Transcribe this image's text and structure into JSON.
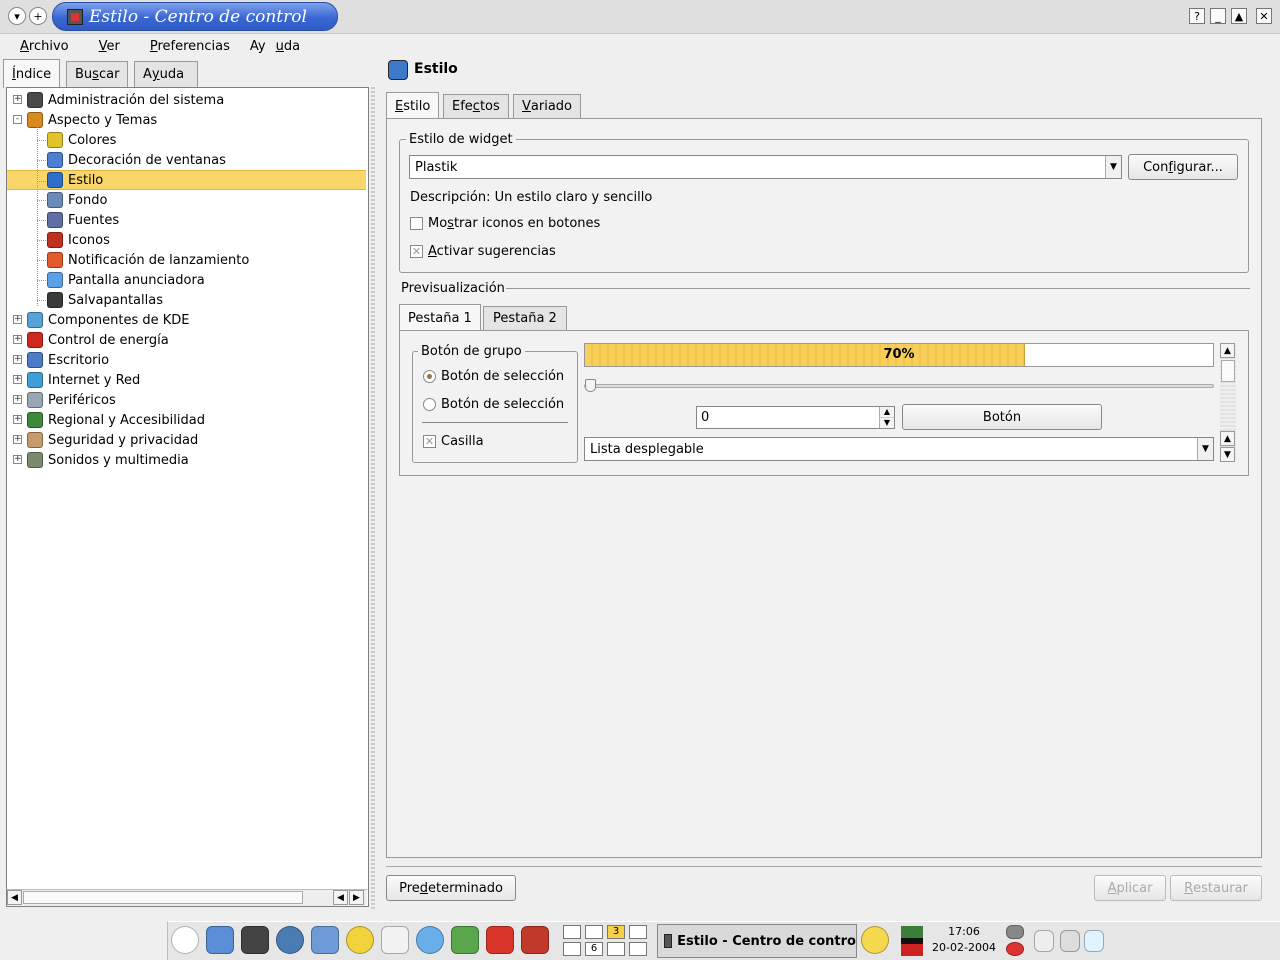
{
  "window": {
    "title": "Estilo - Centro de control"
  },
  "menu": [
    {
      "pre": "",
      "key": "A",
      "post": "rchivo"
    },
    {
      "pre": "",
      "key": "V",
      "post": "er"
    },
    {
      "pre": "",
      "key": "P",
      "post": "referencias"
    },
    {
      "pre": "Ay",
      "key": "u",
      "post": "da"
    }
  ],
  "sidebar_tabs": [
    {
      "pre": "",
      "key": "Í",
      "post": "ndice"
    },
    {
      "pre": "Bu",
      "key": "s",
      "post": "car"
    },
    {
      "pre": "A",
      "key": "y",
      "post": "uda"
    }
  ],
  "tree": [
    {
      "label": "Administración del sistema",
      "level": 0,
      "expander": "+",
      "color": "#4a4a4a"
    },
    {
      "label": "Aspecto y Temas",
      "level": 0,
      "expander": "-",
      "color": "#d98a1c"
    },
    {
      "label": "Colores",
      "level": 1,
      "color": "#e0c22a"
    },
    {
      "label": "Decoración de ventanas",
      "level": 1,
      "color": "#4d7fd0"
    },
    {
      "label": "Estilo",
      "level": 1,
      "color": "#2f6fcc",
      "selected": true
    },
    {
      "label": "Fondo",
      "level": 1,
      "color": "#6a8bb8"
    },
    {
      "label": "Fuentes",
      "level": 1,
      "color": "#5f6fa3"
    },
    {
      "label": "Iconos",
      "level": 1,
      "color": "#c03020"
    },
    {
      "label": "Notificación de lanzamiento",
      "level": 1,
      "color": "#e25a2b"
    },
    {
      "label": "Pantalla anunciadora",
      "level": 1,
      "color": "#5aa0e6"
    },
    {
      "label": "Salvapantallas",
      "level": 1,
      "color": "#3a3a3a"
    },
    {
      "label": "Componentes de KDE",
      "level": 0,
      "expander": "+",
      "color": "#55a3d8"
    },
    {
      "label": "Control de energía",
      "level": 0,
      "expander": "+",
      "color": "#cc2a1e"
    },
    {
      "label": "Escritorio",
      "level": 0,
      "expander": "+",
      "color": "#4a7cc8"
    },
    {
      "label": "Internet y Red",
      "level": 0,
      "expander": "+",
      "color": "#3e9fd6"
    },
    {
      "label": "Periféricos",
      "level": 0,
      "expander": "+",
      "color": "#9aa6b4"
    },
    {
      "label": "Regional y Accesibilidad",
      "level": 0,
      "expander": "+",
      "color": "#3f8a3a"
    },
    {
      "label": "Seguridad y privacidad",
      "level": 0,
      "expander": "+",
      "color": "#c69a6a"
    },
    {
      "label": "Sonidos y multimedia",
      "level": 0,
      "expander": "+",
      "color": "#7a8a6a"
    }
  ],
  "module": {
    "title": "Estilo"
  },
  "tabs": [
    {
      "pre": "",
      "key": "E",
      "post": "stilo"
    },
    {
      "pre": "Efe",
      "key": "c",
      "post": "tos"
    },
    {
      "pre": "",
      "key": "V",
      "post": "ariado"
    }
  ],
  "widget_style": {
    "group_title": "Estilo de widget",
    "selected": "Plastik",
    "configure": {
      "pre": "Con",
      "key": "f",
      "post": "igurar..."
    },
    "description": "Descripción: Un estilo claro y sencillo",
    "show_icons": {
      "pre": "Mo",
      "key": "s",
      "post": "trar iconos en botones",
      "checked": false
    },
    "tooltips": {
      "pre": "",
      "key": "A",
      "post": "ctivar sugerencias",
      "checked": true
    }
  },
  "preview": {
    "title": "Previsualización",
    "tabs": [
      "Pestaña 1",
      "Pestaña 2"
    ],
    "group_title": "Botón de grupo",
    "radio1": "Botón de selección",
    "radio2": "Botón de selección",
    "checkbox": "Casilla",
    "progress_label": "70%",
    "progress_value": 0.7,
    "spin_value": "0",
    "button": "Botón",
    "combo": "Lista desplegable"
  },
  "bottom": {
    "defaults": {
      "pre": "Pre",
      "key": "d",
      "post": "eterminado"
    },
    "apply": {
      "pre": "",
      "key": "A",
      "post": "plicar"
    },
    "reset": {
      "pre": "",
      "key": "R",
      "post": "estaurar"
    }
  },
  "taskbar": {
    "desktops": [
      "",
      "",
      "3",
      "",
      "",
      "6",
      "",
      ""
    ],
    "task_title": "Estilo - Centro de contro",
    "time": "17:06",
    "date": "20-02-2004"
  },
  "colors": {
    "selection": "#f9d669",
    "progress": "#f7cf5a",
    "titlebar": "#3a67d4"
  }
}
